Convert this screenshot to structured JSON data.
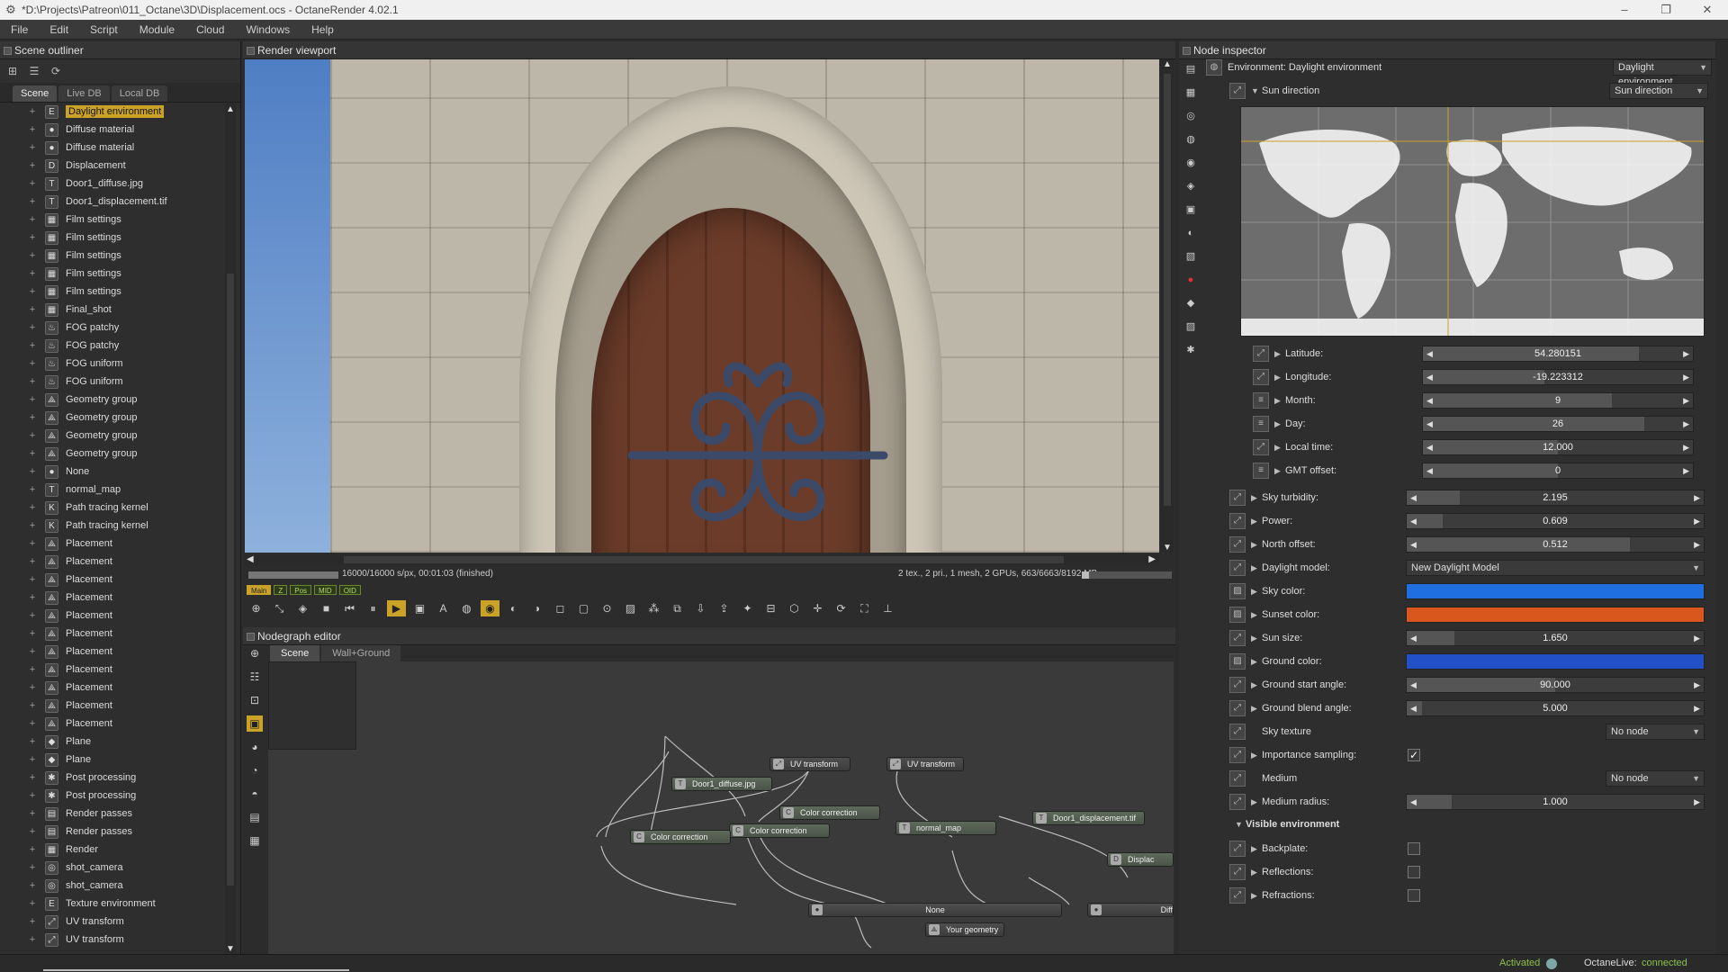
{
  "window": {
    "title": "*D:\\Projects\\Patreon\\011_Octane\\3D\\Displacement.ocs - OctaneRender 4.02.1",
    "minimize": "–",
    "maximize": "❐",
    "close": "✕"
  },
  "menu": [
    "File",
    "Edit",
    "Script",
    "Module",
    "Cloud",
    "Windows",
    "Help"
  ],
  "outliner": {
    "title": "Scene outliner",
    "tabs": [
      "Scene",
      "Live DB",
      "Local DB"
    ],
    "items": [
      {
        "label": "Daylight environment",
        "icon": "E"
      },
      {
        "label": "Diffuse material",
        "icon": "●"
      },
      {
        "label": "Diffuse material",
        "icon": "●"
      },
      {
        "label": "Displacement",
        "icon": "D"
      },
      {
        "label": "Door1_diffuse.jpg",
        "icon": "T"
      },
      {
        "label": "Door1_displacement.tif",
        "icon": "T"
      },
      {
        "label": "Film settings",
        "icon": "▦"
      },
      {
        "label": "Film settings",
        "icon": "▦"
      },
      {
        "label": "Film settings",
        "icon": "▦"
      },
      {
        "label": "Film settings",
        "icon": "▦"
      },
      {
        "label": "Film settings",
        "icon": "▦"
      },
      {
        "label": "Final_shot",
        "icon": "▦"
      },
      {
        "label": "FOG patchy",
        "icon": "♨"
      },
      {
        "label": "FOG patchy",
        "icon": "♨"
      },
      {
        "label": "FOG uniform",
        "icon": "♨"
      },
      {
        "label": "FOG uniform",
        "icon": "♨"
      },
      {
        "label": "Geometry group",
        "icon": "⟁"
      },
      {
        "label": "Geometry group",
        "icon": "⟁"
      },
      {
        "label": "Geometry group",
        "icon": "⟁"
      },
      {
        "label": "Geometry group",
        "icon": "⟁"
      },
      {
        "label": "None",
        "icon": "●"
      },
      {
        "label": "normal_map",
        "icon": "T"
      },
      {
        "label": "Path tracing kernel",
        "icon": "K"
      },
      {
        "label": "Path tracing kernel",
        "icon": "K"
      },
      {
        "label": "Placement",
        "icon": "⟁"
      },
      {
        "label": "Placement",
        "icon": "⟁"
      },
      {
        "label": "Placement",
        "icon": "⟁"
      },
      {
        "label": "Placement",
        "icon": "⟁"
      },
      {
        "label": "Placement",
        "icon": "⟁"
      },
      {
        "label": "Placement",
        "icon": "⟁"
      },
      {
        "label": "Placement",
        "icon": "⟁"
      },
      {
        "label": "Placement",
        "icon": "⟁"
      },
      {
        "label": "Placement",
        "icon": "⟁"
      },
      {
        "label": "Placement",
        "icon": "⟁"
      },
      {
        "label": "Placement",
        "icon": "⟁"
      },
      {
        "label": "Plane",
        "icon": "◆"
      },
      {
        "label": "Plane",
        "icon": "◆"
      },
      {
        "label": "Post processing",
        "icon": "✱"
      },
      {
        "label": "Post processing",
        "icon": "✱"
      },
      {
        "label": "Render passes",
        "icon": "▤"
      },
      {
        "label": "Render passes",
        "icon": "▤"
      },
      {
        "label": "Render",
        "icon": "▦"
      },
      {
        "label": "shot_camera",
        "icon": "◎"
      },
      {
        "label": "shot_camera",
        "icon": "◎"
      },
      {
        "label": "Texture environment",
        "icon": "E"
      },
      {
        "label": "UV transform",
        "icon": "⤢"
      },
      {
        "label": "UV transform",
        "icon": "⤢"
      }
    ]
  },
  "viewport": {
    "title": "Render viewport",
    "status_left": "16000/16000 s/px, 00:01:03 (finished)",
    "status_right": "2 tex., 2 pri., 1 mesh, 2 GPUs, 663/6663/8192 MB",
    "memory_fraction": 0.08,
    "badges": [
      "Main",
      "Z",
      "Pos",
      "MID",
      "OID"
    ]
  },
  "nodegraph": {
    "title": "Nodegraph editor",
    "tabs": [
      "Scene",
      "Wall+Ground"
    ],
    "nodes": [
      {
        "label": "UV transform"
      },
      {
        "label": "UV transform"
      },
      {
        "label": "Door1_diffuse.jpg"
      },
      {
        "label": "Color correction"
      },
      {
        "label": "Color correction"
      },
      {
        "label": "Color correction"
      },
      {
        "label": "normal_map"
      },
      {
        "label": "Door1_displacement.tif"
      },
      {
        "label": "Displac"
      },
      {
        "label": "None"
      },
      {
        "label": "Diff"
      },
      {
        "label": "Your geometry"
      }
    ]
  },
  "inspector": {
    "title": "Node inspector",
    "node_title": "Environment: Daylight environment",
    "node_dropdown": "Daylight environment",
    "sun_direction": {
      "label": "Sun direction",
      "dropdown": "Sun direction",
      "params": [
        {
          "label": "Latitude:",
          "value": "54.280151",
          "fill": 0.8
        },
        {
          "label": "Longitude:",
          "value": "-19.223312",
          "fill": 0.45
        },
        {
          "label": "Month:",
          "value": "9",
          "fill": 0.7
        },
        {
          "label": "Day:",
          "value": "26",
          "fill": 0.82
        },
        {
          "label": "Local time:",
          "value": "12.000",
          "fill": 0.5
        },
        {
          "label": "GMT offset:",
          "value": "0",
          "fill": 0.5
        }
      ]
    },
    "params": [
      {
        "label": "Sky turbidity:",
        "value": "2.195",
        "fill": 0.18
      },
      {
        "label": "Power:",
        "value": "0.609",
        "fill": 0.12
      },
      {
        "label": "North offset:",
        "value": "0.512",
        "fill": 0.75
      },
      {
        "label": "Daylight model:",
        "value": "New Daylight Model"
      },
      {
        "label": "Sky color:",
        "color": "#1f6fe0"
      },
      {
        "label": "Sunset color:",
        "color": "#d9561c"
      },
      {
        "label": "Sun size:",
        "value": "1.650",
        "fill": 0.16
      },
      {
        "label": "Ground color:",
        "color": "#2150c8"
      },
      {
        "label": "Ground start angle:",
        "value": "90.000",
        "fill": 0.5
      },
      {
        "label": "Ground blend angle:",
        "value": "5.000",
        "fill": 0.05
      },
      {
        "label": "Sky texture",
        "value": "No node"
      },
      {
        "label": "Importance sampling:",
        "checked": true
      },
      {
        "label": "Medium",
        "value": "No node"
      },
      {
        "label": "Medium radius:",
        "value": "1.000",
        "fill": 0.15
      }
    ],
    "visible_env": {
      "label": "Visible environment",
      "items": [
        {
          "label": "Backplate:"
        },
        {
          "label": "Reflections:"
        },
        {
          "label": "Refractions:"
        }
      ]
    }
  },
  "status": {
    "activated": "Activated",
    "live_label": "OctaneLive:",
    "live_state": "connected"
  },
  "colors": {
    "accent": "#c9a227",
    "status_green": "#8dc04a"
  }
}
